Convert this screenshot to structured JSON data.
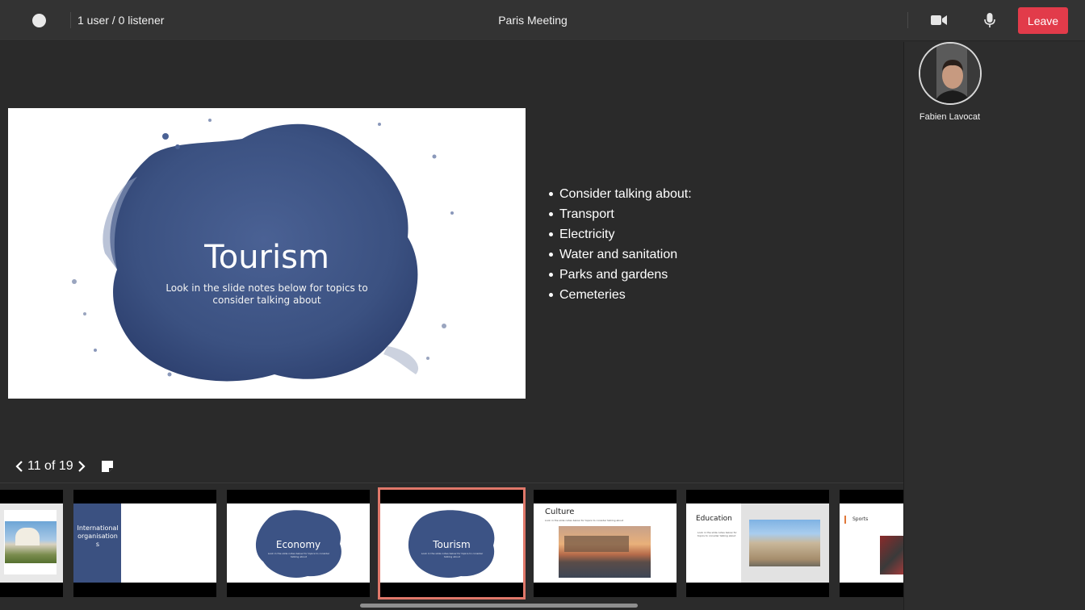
{
  "topbar": {
    "user_count": "1 user / 0 listener",
    "meeting_title": "Paris Meeting",
    "leave_label": "Leave"
  },
  "participant": {
    "name": "Fabien Lavocat"
  },
  "slide": {
    "title": "Tourism",
    "subtitle": "Look in the slide notes below for topics to consider talking about"
  },
  "notes": [
    "Consider talking about:",
    "Transport",
    "Electricity",
    "Water and sanitation",
    "Parks and gardens",
    "Cemeteries"
  ],
  "pager": {
    "text": "11 of 19"
  },
  "thumbnails": [
    {
      "title": ""
    },
    {
      "title": "International organisations"
    },
    {
      "title": "Economy",
      "subtitle": "Look in the slide notes below for topics to consider talking about"
    },
    {
      "title": "Tourism",
      "subtitle": "Look in the slide notes below for topics to consider talking about"
    },
    {
      "title": "Culture",
      "subtitle": "Look in the slide notes below for topics to consider talking about"
    },
    {
      "title": "Education",
      "subtitle": "Look in the slide notes below for topics to consider talking about"
    },
    {
      "title": "Sports"
    }
  ],
  "colors": {
    "leave": "#e23b4a",
    "active_thumb": "#e0786a",
    "splash": "#3c5385"
  }
}
